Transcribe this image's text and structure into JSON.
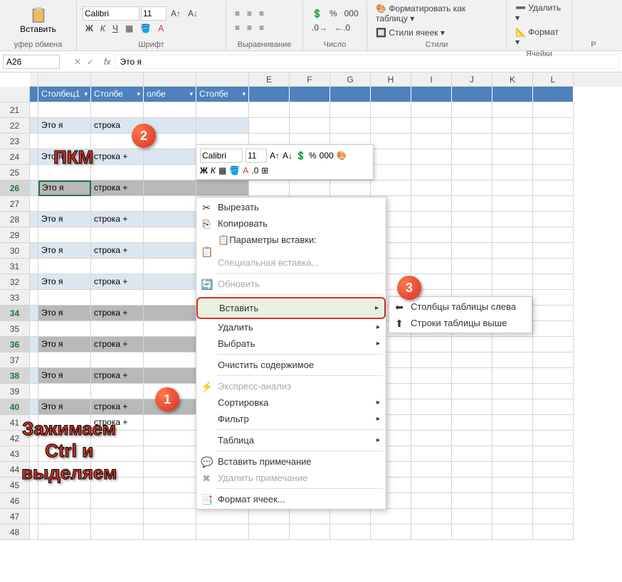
{
  "ribbon": {
    "paste_label": "Вставить",
    "clipboard_label": "уфер обмена",
    "font_name": "Calibri",
    "font_size": "11",
    "bold": "Ж",
    "italic": "К",
    "underline": "Ч",
    "font_label": "Шрифт",
    "align_label": "Выравнивание",
    "number_percent": "%",
    "number_thousand": "000",
    "number_label": "Число",
    "format_table": "Форматировать как таблицу",
    "cell_styles": "Стили ячеек",
    "styles_label": "Стили",
    "delete_label": "Удалить",
    "format_label": "Формат",
    "cells_label": "Ячейки",
    "edit_label": "Р"
  },
  "formula": {
    "cell_ref": "A26",
    "fx": "fx",
    "value": "Это я"
  },
  "columns": [
    "E",
    "F",
    "G",
    "H",
    "I",
    "J",
    "K",
    "L"
  ],
  "table_headers": [
    "Столбец1",
    "Столбе",
    "олбе",
    "Столбе"
  ],
  "rows": [
    {
      "n": 21,
      "a": "",
      "b": "",
      "banded": false
    },
    {
      "n": 22,
      "a": "Это я",
      "b": "строка",
      "banded": true
    },
    {
      "n": 23,
      "a": "",
      "b": "",
      "banded": false
    },
    {
      "n": 24,
      "a": "Это я",
      "b": "строка +",
      "banded": true
    },
    {
      "n": 25,
      "a": "",
      "b": "",
      "banded": false
    },
    {
      "n": 26,
      "a": "Это я",
      "b": "строка +",
      "banded": true,
      "sel": true,
      "active": true
    },
    {
      "n": 27,
      "a": "",
      "b": "",
      "banded": false
    },
    {
      "n": 28,
      "a": "Это я",
      "b": "строка +",
      "banded": true
    },
    {
      "n": 29,
      "a": "",
      "b": "",
      "banded": false
    },
    {
      "n": 30,
      "a": "Это я",
      "b": "строка +",
      "banded": true
    },
    {
      "n": 31,
      "a": "",
      "b": "",
      "banded": false
    },
    {
      "n": 32,
      "a": "Это я",
      "b": "строка +",
      "banded": true
    },
    {
      "n": 33,
      "a": "",
      "b": "",
      "banded": false
    },
    {
      "n": 34,
      "a": "Это я",
      "b": "строка +",
      "banded": true,
      "sel": true
    },
    {
      "n": 35,
      "a": "",
      "b": "",
      "banded": false
    },
    {
      "n": 36,
      "a": "Это я",
      "b": "строка +",
      "banded": true,
      "sel": true
    },
    {
      "n": 37,
      "a": "",
      "b": "",
      "banded": false
    },
    {
      "n": 38,
      "a": "Это я",
      "b": "строка +",
      "banded": true,
      "sel": true
    },
    {
      "n": 39,
      "a": "",
      "b": "",
      "banded": false
    },
    {
      "n": 40,
      "a": "Это я",
      "b": "строка +",
      "banded": true,
      "sel": true
    },
    {
      "n": 41,
      "a": "",
      "b": "строка +",
      "banded": false
    },
    {
      "n": 42,
      "a": "",
      "b": "",
      "banded": false
    },
    {
      "n": 43,
      "a": "",
      "b": "",
      "banded": false
    },
    {
      "n": 44,
      "a": "",
      "b": "",
      "banded": false
    },
    {
      "n": 45,
      "a": "",
      "b": "",
      "banded": false
    },
    {
      "n": 46,
      "a": "",
      "b": "",
      "banded": false
    },
    {
      "n": 47,
      "a": "",
      "b": "",
      "banded": false
    },
    {
      "n": 48,
      "a": "",
      "b": "",
      "banded": false
    }
  ],
  "mini": {
    "font": "Calibri",
    "size": "11",
    "percent": "%",
    "thousand": "000",
    "bold": "Ж",
    "italic": "К"
  },
  "menu": {
    "cut": "Вырезать",
    "copy": "Копировать",
    "paste_options": "Параметры вставки:",
    "paste_special": "Специальная вставка...",
    "refresh": "Обновить",
    "insert": "Вставить",
    "delete": "Удалить",
    "select": "Выбрать",
    "clear": "Очистить содержимое",
    "quick_analysis": "Экспресс-анализ",
    "sort": "Сортировка",
    "filter": "Фильтр",
    "table": "Таблица",
    "insert_comment": "Вставить примечание",
    "delete_comment": "Удалить примечание",
    "format_cells": "Формат ячеек..."
  },
  "submenu": {
    "cols_left": "Столбцы таблицы слева",
    "rows_above": "Строки таблицы выше"
  },
  "annotations": {
    "pkm": "ПКМ",
    "hold_ctrl": "Зажимаем\nCtrl и\nвыделяем",
    "b1": "1",
    "b2": "2",
    "b3": "3"
  }
}
